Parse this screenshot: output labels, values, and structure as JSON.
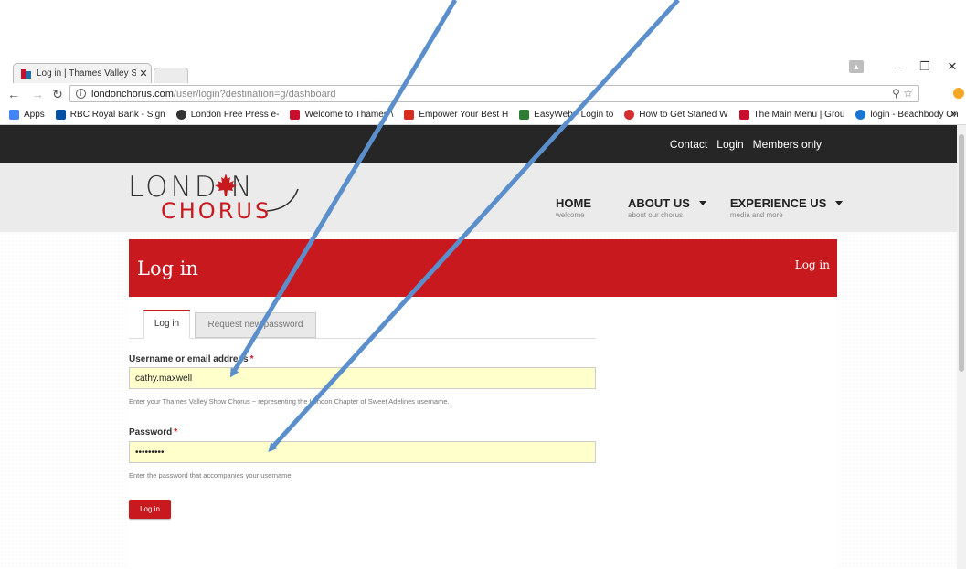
{
  "browser": {
    "tab_title": "Log in | Thames Valley Sh",
    "url_host": "londonchorus.com",
    "url_path": "/user/login?destination=g/dashboard",
    "bookmarks": [
      {
        "label": "Apps",
        "color": "#4285f4"
      },
      {
        "label": "RBC Royal Bank - Sign",
        "color": "#0051a5"
      },
      {
        "label": "London Free Press e-",
        "color": "#333333"
      },
      {
        "label": "Welcome to Thames \\",
        "color": "#c8102e"
      },
      {
        "label": "Empower Your Best H",
        "color": "#d62d20"
      },
      {
        "label": "EasyWeb - Login to",
        "color": "#2e7d32"
      },
      {
        "label": "How to Get Started W",
        "color": "#d32f2f"
      },
      {
        "label": "The Main Menu | Grou",
        "color": "#c8102e"
      },
      {
        "label": "login - Beachbody On",
        "color": "#1976d2"
      }
    ],
    "more_label": "»"
  },
  "site": {
    "top_links": [
      "Contact",
      "Login",
      "Members only"
    ],
    "logo_top": "LOND N",
    "logo_bottom": "CHORUS",
    "nav": [
      {
        "label": "HOME",
        "sub": "welcome"
      },
      {
        "label": "ABOUT US",
        "sub": "about our chorus"
      },
      {
        "label": "EXPERIENCE US",
        "sub": "media and more"
      }
    ],
    "accent": "#c8191e"
  },
  "page": {
    "title": "Log in",
    "breadcrumb": "Log in",
    "tabs": {
      "active": "Log in",
      "other": "Request new password"
    },
    "username": {
      "label": "Username or email address",
      "required_mark": "*",
      "value": "cathy.maxwell",
      "description": "Enter your Thames Valley Show Chorus ~ representing the London Chapter of Sweet Adelines username."
    },
    "password": {
      "label": "Password",
      "required_mark": "*",
      "value": "•••••••••",
      "description": "Enter the password that accompanies your username."
    },
    "submit_label": "Log in"
  }
}
